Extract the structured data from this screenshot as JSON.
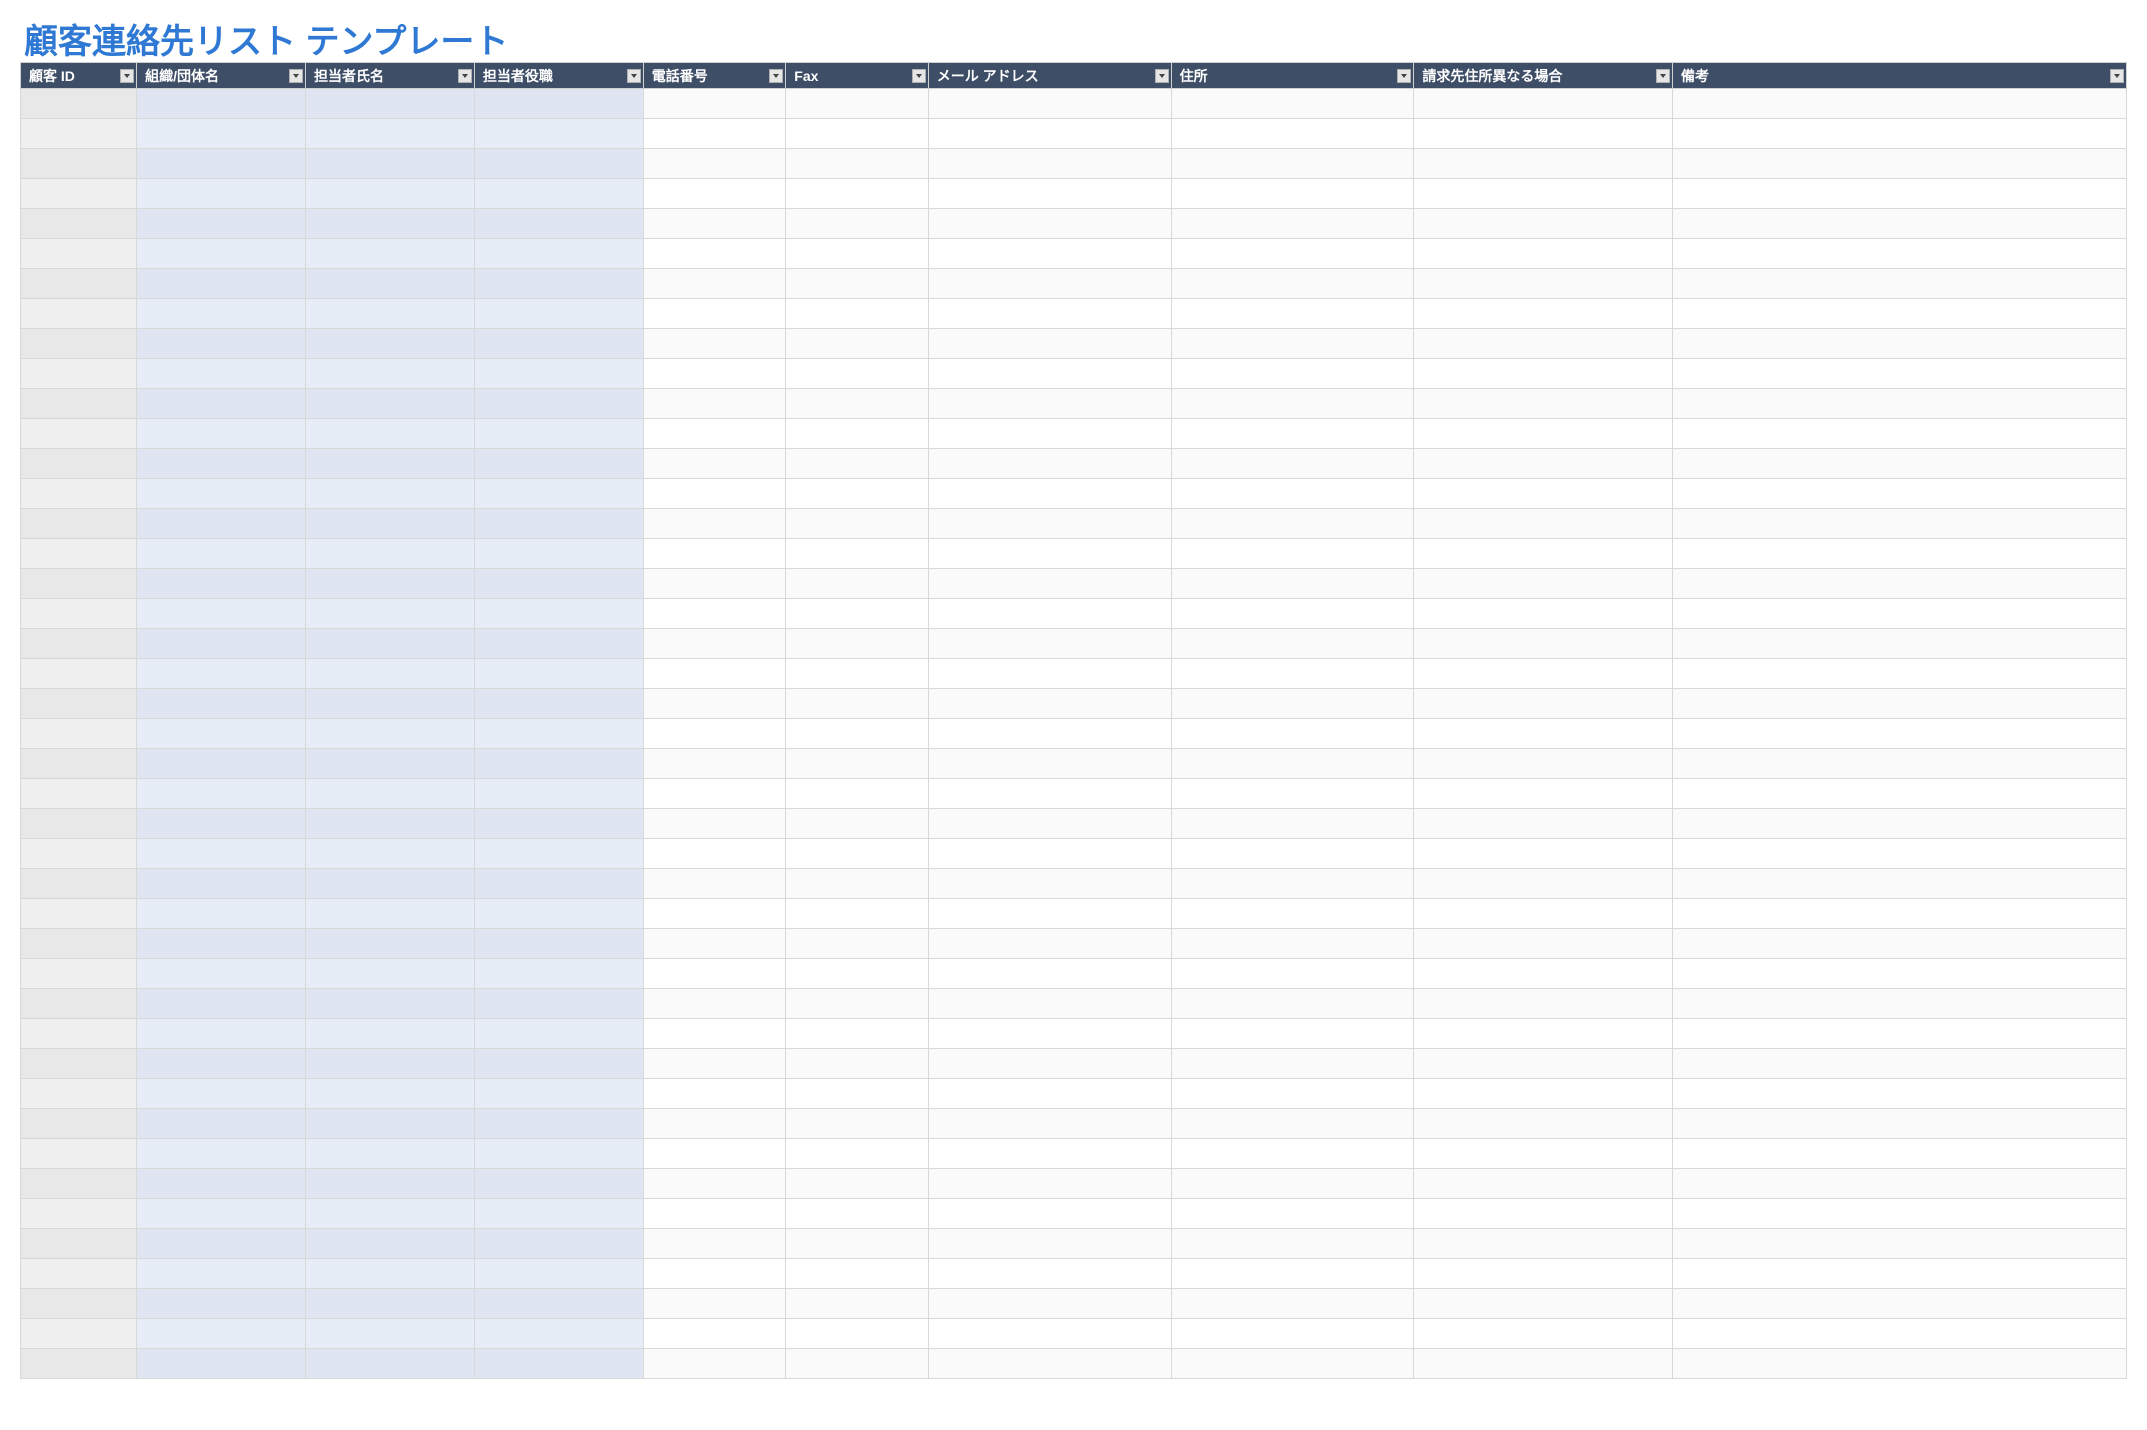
{
  "header": {
    "title": "顧客連絡先リスト テンプレート"
  },
  "table": {
    "columns": [
      {
        "label": "顧客 ID",
        "key": "id",
        "cls": "col-id",
        "wcls": "w-id"
      },
      {
        "label": "組織/団体名",
        "key": "org",
        "cls": "col-blue",
        "wcls": "w-org"
      },
      {
        "label": "担当者氏名",
        "key": "name",
        "cls": "col-blue",
        "wcls": "w-name"
      },
      {
        "label": "担当者役職",
        "key": "role",
        "cls": "col-blue",
        "wcls": "w-role"
      },
      {
        "label": "電話番号",
        "key": "tel",
        "cls": "col-white",
        "wcls": "w-tel"
      },
      {
        "label": "Fax",
        "key": "fax",
        "cls": "col-white",
        "wcls": "w-fax"
      },
      {
        "label": "メール アドレス",
        "key": "mail",
        "cls": "col-white",
        "wcls": "w-mail"
      },
      {
        "label": "住所",
        "key": "addr",
        "cls": "col-white",
        "wcls": "w-addr"
      },
      {
        "label": "請求先住所異なる場合",
        "key": "bill",
        "cls": "col-white",
        "wcls": "w-bill"
      },
      {
        "label": "備考",
        "key": "note",
        "cls": "col-white",
        "wcls": "w-note"
      }
    ],
    "row_count": 43
  }
}
